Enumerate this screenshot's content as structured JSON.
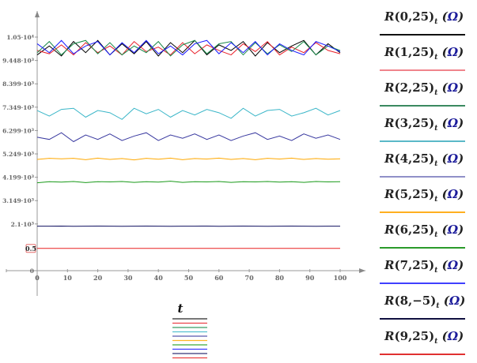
{
  "chart_data": {
    "type": "line",
    "xlabel": "t",
    "xlim": [
      0,
      100
    ],
    "ylim": [
      0,
      10500
    ],
    "xticks": [
      "0",
      "10",
      "20",
      "30",
      "40",
      "50",
      "60",
      "70",
      "80",
      "90",
      "100"
    ],
    "yticks": [
      {
        "v": 0,
        "label": "0"
      },
      {
        "v": 2100,
        "label": "2.1·10³"
      },
      {
        "v": 3149,
        "label": "3.149·10³"
      },
      {
        "v": 4199,
        "label": "4.199·10³"
      },
      {
        "v": 5249,
        "label": "5.249·10³"
      },
      {
        "v": 6299,
        "label": "6.299·10³"
      },
      {
        "v": 7349,
        "label": "7.349·10³"
      },
      {
        "v": 8399,
        "label": "8.399·10³"
      },
      {
        "v": 9448,
        "label": "9.448·10³"
      },
      {
        "v": 10500,
        "label": "1.05·10⁴"
      }
    ],
    "marker": {
      "v": 1000,
      "label": "0.5"
    },
    "x": [
      0,
      4,
      8,
      12,
      16,
      20,
      24,
      28,
      32,
      36,
      40,
      44,
      48,
      52,
      56,
      60,
      64,
      68,
      72,
      76,
      80,
      84,
      88,
      92,
      96,
      100
    ],
    "series": [
      {
        "name": "R(0,25)t (Ω)",
        "color": "#000000",
        "values": [
          9700,
          10100,
          9650,
          10300,
          9800,
          10350,
          9700,
          10200,
          9750,
          10300,
          9650,
          10250,
          9800,
          10350,
          9700,
          10150,
          9900,
          10300,
          9650,
          10250,
          9800,
          10100,
          10350,
          9700,
          10200,
          9800
        ]
      },
      {
        "name": "R(1,25)t (Ω)",
        "color": "#e8202a",
        "values": [
          9900,
          9750,
          10150,
          9700,
          10250,
          9800,
          10100,
          9700,
          10300,
          9850,
          10050,
          9700,
          10250,
          9750,
          10150,
          9900,
          9700,
          10200,
          9850,
          10300,
          9700,
          10050,
          9800,
          10250,
          9900,
          9750
        ]
      },
      {
        "name": "R(2,25)t (Ω)",
        "color": "#1a8a4a",
        "values": [
          9800,
          10300,
          9700,
          10200,
          10350,
          9750,
          10250,
          9700,
          10100,
          9800,
          10300,
          9650,
          10150,
          10350,
          9750,
          10200,
          10300,
          9700,
          10250,
          9750,
          10150,
          9850,
          10300,
          9700,
          10100,
          9900
        ]
      },
      {
        "name": "R(3,25)t (Ω)",
        "color": "#3ab6c8",
        "values": [
          7200,
          6950,
          7250,
          7300,
          6900,
          7200,
          7100,
          6800,
          7300,
          7050,
          7250,
          6900,
          7200,
          7000,
          7250,
          7100,
          6850,
          7300,
          6950,
          7200,
          7250,
          6950,
          7100,
          7300,
          7000,
          7200
        ]
      },
      {
        "name": "R(4,25)t (Ω)",
        "color": "#3a3aa0",
        "values": [
          6000,
          5900,
          6200,
          5800,
          6100,
          5900,
          6150,
          5850,
          6050,
          6200,
          5850,
          6100,
          5950,
          6150,
          5900,
          6100,
          5850,
          6050,
          6200,
          5900,
          6050,
          5850,
          6150,
          5950,
          6100,
          5900
        ]
      },
      {
        "name": "R(5,25)t (Ω)",
        "color": "#ffa800",
        "values": [
          5000,
          5050,
          5030,
          5050,
          4990,
          5060,
          5000,
          5040,
          4980,
          5050,
          5010,
          5060,
          4990,
          5040,
          5020,
          5060,
          5000,
          5040,
          4990,
          5050,
          5020,
          5060,
          5000,
          5040,
          5010,
          5030
        ]
      },
      {
        "name": "R(6,25)t (Ω)",
        "color": "#1a9a1a",
        "values": [
          3950,
          4000,
          3980,
          4010,
          3960,
          4000,
          3990,
          4010,
          3970,
          4000,
          3980,
          4020,
          3970,
          4000,
          3990,
          4010,
          3970,
          4000,
          3990,
          4010,
          3980,
          4000,
          3970,
          4010,
          3990,
          4000
        ]
      },
      {
        "name": "R(7,25)t (Ω)",
        "color": "#1a1aff",
        "values": [
          10200,
          9800,
          10350,
          9750,
          10100,
          10300,
          9700,
          10250,
          9800,
          10350,
          9750,
          10100,
          9700,
          10200,
          10350,
          9750,
          10250,
          9800,
          10300,
          9700,
          10200,
          9900,
          9700,
          10300,
          10100,
          9850
        ]
      },
      {
        "name": "R(8,−5)t (Ω)",
        "color": "#101060",
        "values": [
          2000,
          2000,
          2005,
          1995,
          2000,
          2005,
          2000,
          1995,
          2000,
          2005,
          2000,
          1995,
          2000,
          2000,
          2005,
          1995,
          2000,
          2005,
          2000,
          1995,
          2000,
          2005,
          2000,
          1995,
          2000,
          2000
        ]
      },
      {
        "name": "R(9,25)t (Ω)",
        "color": "#e82020",
        "values": [
          1000,
          1000,
          1000,
          1000,
          1000,
          1000,
          1000,
          1000,
          1000,
          1000,
          1000,
          1000,
          1000,
          1000,
          1000,
          1000,
          1000,
          1000,
          1000,
          1000,
          1000,
          1000,
          1000,
          1000,
          1000,
          1000
        ]
      }
    ],
    "legend": [
      {
        "fn": "R",
        "args": "(0,25)",
        "color": "#111111"
      },
      {
        "fn": "R",
        "args": "(1,25)",
        "color": "#f0848c"
      },
      {
        "fn": "R",
        "args": "(2,25)",
        "color": "#3a8a60"
      },
      {
        "fn": "R",
        "args": "(3,25)",
        "color": "#5ab8c8"
      },
      {
        "fn": "R",
        "args": "(4,25)",
        "color": "#9090c8"
      },
      {
        "fn": "R",
        "args": "(5,25)",
        "color": "#ffb020"
      },
      {
        "fn": "R",
        "args": "(6,25)",
        "color": "#2a9a2a"
      },
      {
        "fn": "R",
        "args": "(7,25)",
        "color": "#4040ff"
      },
      {
        "fn": "R",
        "args": "(8,−5)",
        "color": "#101040"
      },
      {
        "fn": "R",
        "args": "(9,25)",
        "color": "#e03030"
      }
    ],
    "legend_sub": "t",
    "legend_unit": "Ω"
  }
}
